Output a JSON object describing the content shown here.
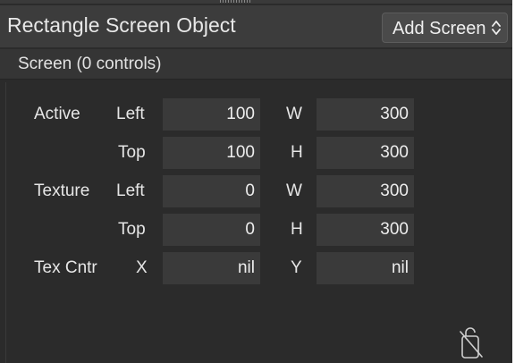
{
  "header": {
    "title": "Rectangle Screen Object",
    "add_screen_label": "Add Screen",
    "add_screen_icon": "updown-chevron-icon"
  },
  "subheader": {
    "label": "Screen (0 controls)"
  },
  "groups": {
    "active": {
      "label": "Active",
      "row1": {
        "label": "Left",
        "value": "100",
        "dim_label": "W",
        "dim_value": "300"
      },
      "row2": {
        "label": "Top",
        "value": "100",
        "dim_label": "H",
        "dim_value": "300"
      }
    },
    "texture": {
      "label": "Texture",
      "row1": {
        "label": "Left",
        "value": "0",
        "dim_label": "W",
        "dim_value": "300"
      },
      "row2": {
        "label": "Top",
        "value": "0",
        "dim_label": "H",
        "dim_value": "300"
      }
    },
    "tex_center": {
      "label": "Tex Cntr",
      "x_label": "X",
      "x_value": "nil",
      "y_label": "Y",
      "y_value": "nil"
    }
  },
  "footer": {
    "icon": "unlock-icon"
  },
  "colors": {
    "panel_bg": "#2b2b2b",
    "header_bg": "#3c3c3c",
    "field_bg": "#3a3a3a",
    "text": "#e6e6e6"
  }
}
